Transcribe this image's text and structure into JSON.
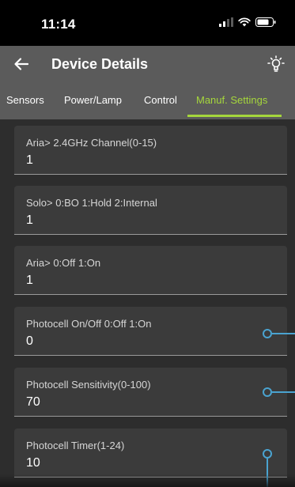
{
  "status_bar": {
    "time": "11:14"
  },
  "app_bar": {
    "title": "Device Details",
    "back_icon": "arrow-left-icon",
    "action_icon": "lightbulb-icon"
  },
  "tabs": [
    {
      "label": "Sensors",
      "active": false
    },
    {
      "label": "Power/Lamp",
      "active": false
    },
    {
      "label": "Control",
      "active": false
    },
    {
      "label": "Manuf. Settings",
      "active": true
    }
  ],
  "fields": [
    {
      "label": "Aria> 2.4GHz Channel(0-15)",
      "value": "1"
    },
    {
      "label": "Solo> 0:BO 1:Hold 2:Internal",
      "value": "1"
    },
    {
      "label": "Aria> 0:Off 1:On",
      "value": "1"
    },
    {
      "label": "Photocell On/Off 0:Off 1:On",
      "value": "0"
    },
    {
      "label": "Photocell Sensitivity(0-100)",
      "value": "70"
    },
    {
      "label": "Photocell Timer(1-24)",
      "value": "10"
    }
  ],
  "colors": {
    "accent": "#a5d63c",
    "app_bar": "#5b5b5b",
    "background": "#2d2d2d",
    "field_background": "#3b3b3b",
    "tutorial_marker": "#4aa3d0"
  }
}
